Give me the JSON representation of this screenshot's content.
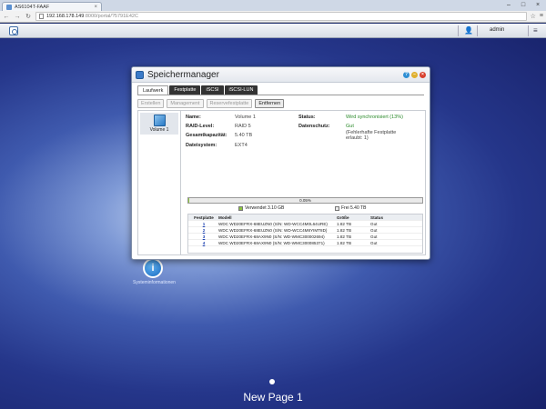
{
  "browser": {
    "tab_title": "AS6104T-FAAF",
    "url_host": "192.168.178.149",
    "url_path": ":8000/portal/?5791E42C"
  },
  "nasbar": {
    "username": "admin"
  },
  "window": {
    "title": "Speichermanager",
    "tabs": [
      {
        "label": "Laufwerk",
        "active": true
      },
      {
        "label": "Festplatte",
        "active": false
      },
      {
        "label": "iSCSI",
        "active": false
      },
      {
        "label": "iSCSI-LUN",
        "active": false
      }
    ],
    "toolbar": {
      "create": "Erstellen",
      "management": "Management",
      "spare": "Reservefestplatte",
      "remove": "Entfernen"
    },
    "volume_label": "Volume 1",
    "details": {
      "name_label": "Name:",
      "name_value": "Volume 1",
      "raid_label": "RAID-Level:",
      "raid_value": "RAID 5",
      "capacity_label": "Gesamtkapazität:",
      "capacity_value": "5.40 TB",
      "fs_label": "Dateisystem:",
      "fs_value": "EXT4",
      "status_label": "Status:",
      "status_value": "Wird synchronisiert (13%)",
      "protection_label": "Datenschutz:",
      "protection_value": "Gut",
      "protection_note_1": "(Fehlerhafte Festplatte",
      "protection_note_2": "erlaubt: 1)"
    },
    "usage": {
      "percent": 0.05,
      "percent_label": "0.05%",
      "used_label": "Verwendet 3.10 GB",
      "free_label": "Frei 5.40 TB"
    },
    "disk_table": {
      "headers": [
        "Festplatte",
        "Modell",
        "Größe",
        "Status"
      ],
      "rows": [
        [
          "1",
          "WDC WD20EFRX-68EUZN0 (S/N: WD-WCC4M0L64URE)",
          "1.82 TB",
          "Gut"
        ],
        [
          "2",
          "WDC WD20EFRX-68EUZN0 (S/N: WD-WCC4M8YIMT8D)",
          "1.82 TB",
          "Gut"
        ],
        [
          "3",
          "WDC WD20EFRX-68AX9N0 (S/N: WD-WMC300002694)",
          "1.82 TB",
          "Gut"
        ],
        [
          "4",
          "WDC WD20EFRX-68AX9N0 (S/N: WD-WMC300085371)",
          "1.82 TB",
          "Gut"
        ]
      ]
    }
  },
  "desktop": {
    "icon_letter": "i",
    "icon_label": "Systeminformationen",
    "page_label": "New Page 1"
  },
  "colors": {
    "accent": "#3a7ac8",
    "status_green": "#2a8a2a",
    "usage_fill": "#8cc63f",
    "link": "#1a3fb0"
  }
}
